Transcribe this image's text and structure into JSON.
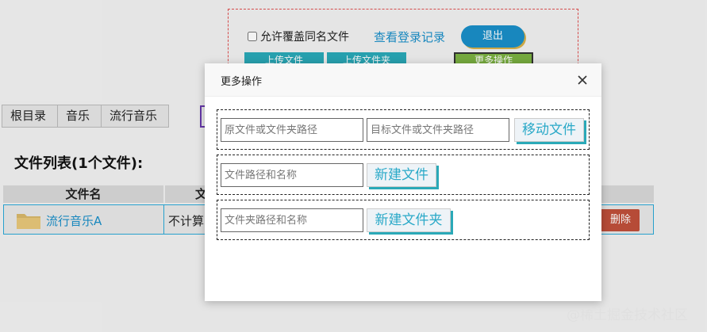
{
  "header": {
    "overwrite_label": "允许覆盖同名文件",
    "login_log_link": "查看登录记录",
    "logout_button": "退出",
    "upload_file_button": "上传文件",
    "upload_folder_button": "上传文件夹",
    "more_ops_button": "更多操作"
  },
  "breadcrumb": [
    "根目录",
    "音乐",
    "流行音乐"
  ],
  "file_list": {
    "title": "文件列表(1个文件):",
    "columns": {
      "name": "文件名",
      "size": "文件"
    },
    "rows": [
      {
        "name": "流行音乐A",
        "size": "不计算",
        "delete": "删除"
      }
    ]
  },
  "modal": {
    "title": "更多操作",
    "move": {
      "source_placeholder": "原文件或文件夹路径",
      "target_placeholder": "目标文件或文件夹路径",
      "button": "移动文件"
    },
    "new_file": {
      "placeholder": "文件路径和名称",
      "button": "新建文件"
    },
    "new_folder": {
      "placeholder": "文件夹路径和名称",
      "button": "新建文件夹"
    }
  },
  "watermark": "@稀土掘金技术社区",
  "colors": {
    "accent": "#2aa9b8",
    "link": "#1a8fc9",
    "danger": "#c0503a",
    "highlight": "#7cb342"
  }
}
